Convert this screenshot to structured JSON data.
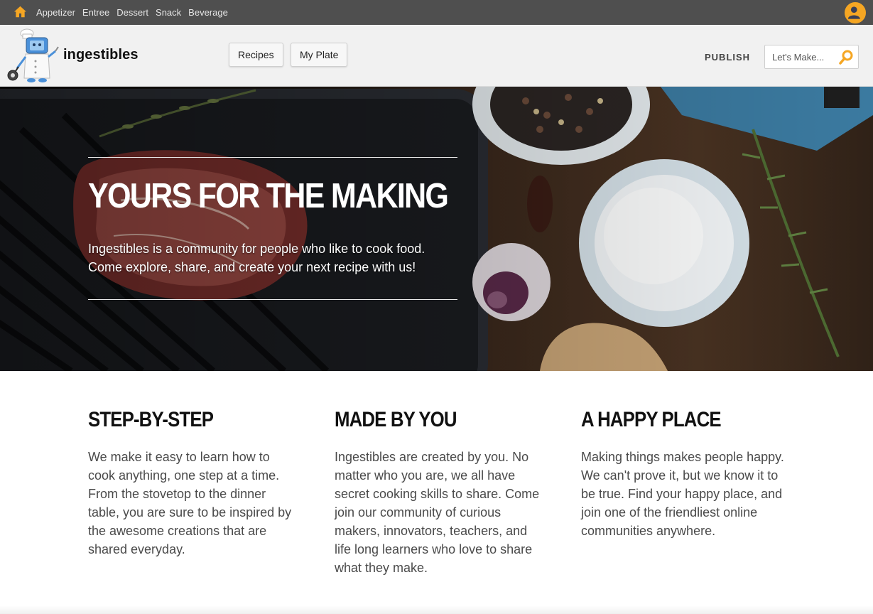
{
  "topbar": {
    "home_icon": "home-icon",
    "categories": [
      "Appetizer",
      "Entree",
      "Dessert",
      "Snack",
      "Beverage"
    ],
    "avatar_icon": "user-avatar-icon"
  },
  "header": {
    "logo_text": "ingestibles",
    "nav_buttons": [
      "Recipes",
      "My Plate"
    ],
    "publish_label": "PUBLISH",
    "search_placeholder": "Let's Make...",
    "search_icon": "search-icon"
  },
  "hero": {
    "title": "YOURS FOR THE MAKING",
    "text_line1": "Ingestibles is a community for people who like to cook food.",
    "text_line2": "Come explore, share, and create your next recipe with us!"
  },
  "features": [
    {
      "title": "STEP-BY-STEP",
      "body": "We make it easy to learn how to cook anything, one step at a time. From the stovetop to the dinner table, you are sure to be inspired by the awesome creations that are shared everyday."
    },
    {
      "title": "MADE BY YOU",
      "body": "Ingestibles are created by you. No matter who you are, we all have secret cooking skills to share. Come join our community of curious makers, innovators, teachers, and life long learners who love to share what they make."
    },
    {
      "title": "A HAPPY PLACE",
      "body": "Making things makes people happy. We can't prove it, but we know it to be true. Find your happy place, and join one of the friendliest online communities anywhere."
    }
  ],
  "colors": {
    "accent": "#f5a623",
    "topbar_bg": "#4f4f4f",
    "header_bg": "#f1f1f1"
  }
}
